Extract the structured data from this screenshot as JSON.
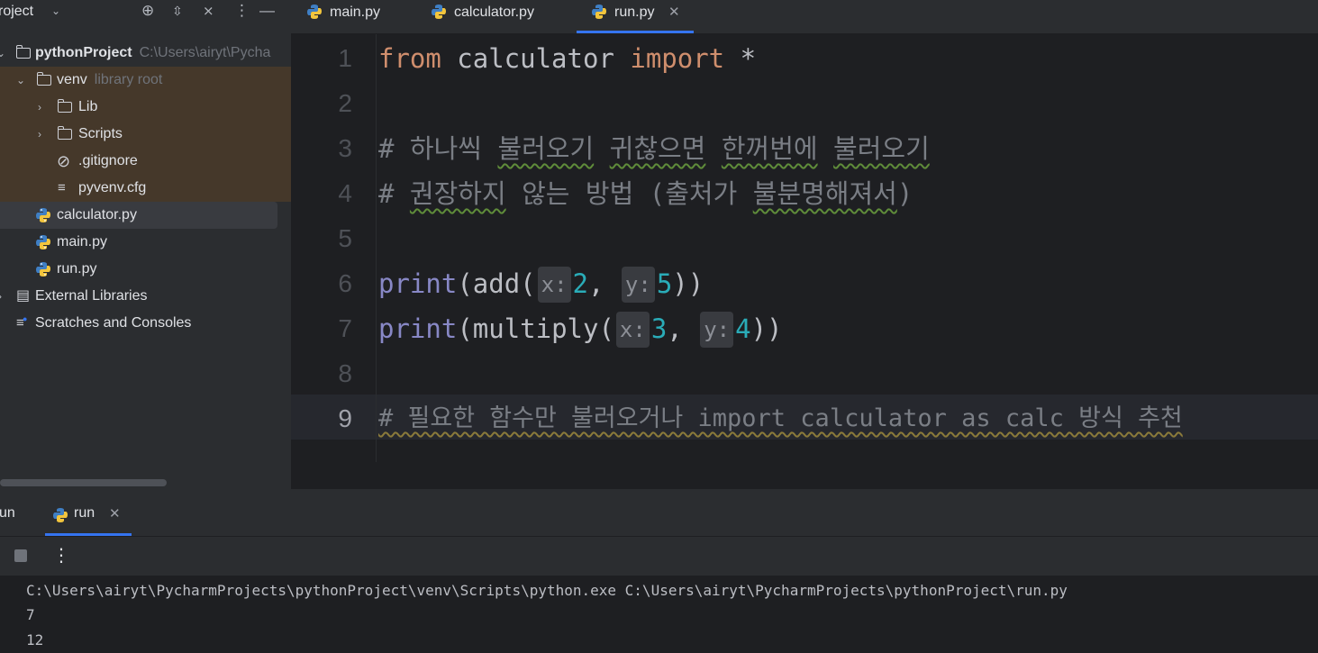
{
  "project": {
    "title": "roject",
    "tree": [
      {
        "label": "pythonProject",
        "hint": "C:\\Users\\airyt\\Pycha",
        "type": "folder"
      },
      {
        "label": "venv",
        "hint": "library root",
        "type": "folder"
      },
      {
        "label": "Lib",
        "type": "folder"
      },
      {
        "label": "Scripts",
        "type": "folder"
      },
      {
        "label": ".gitignore",
        "type": "ignore"
      },
      {
        "label": "pyvenv.cfg",
        "type": "text"
      },
      {
        "label": "calculator.py",
        "type": "python"
      },
      {
        "label": "main.py",
        "type": "python"
      },
      {
        "label": "run.py",
        "type": "python"
      },
      {
        "label": "External Libraries",
        "type": "library"
      },
      {
        "label": "Scratches and Consoles",
        "type": "scratch"
      }
    ]
  },
  "editor": {
    "tabs": [
      {
        "label": "main.py"
      },
      {
        "label": "calculator.py"
      },
      {
        "label": "run.py",
        "active": true
      }
    ],
    "line_numbers": [
      "1",
      "2",
      "3",
      "4",
      "5",
      "6",
      "7",
      "8",
      "9"
    ],
    "code": {
      "l1_kw1": "from",
      "l1_mid": " calculator ",
      "l1_kw2": "import",
      "l1_end": " *",
      "l3_hash": "# ",
      "l3_w1": "하나씩",
      "l3_w2": "불러오기",
      "l3_w3": "귀찮으면",
      "l3_w4": "한꺼번에",
      "l3_w5": "불러오기",
      "l4_hash": "# ",
      "l4_w1": "권장하지",
      "l4_w2": " 않는 방법 (출처가 ",
      "l4_w3": "불분명해져서",
      "l4_end": ")",
      "l6_fn": "print",
      "l6_a": "(add(",
      "l6_h1": "x:",
      "l6_n1": "2",
      "l6_c": ", ",
      "l6_h2": "y:",
      "l6_n2": "5",
      "l6_end": "))",
      "l7_fn": "print",
      "l7_a": "(multiply(",
      "l7_h1": "x:",
      "l7_n1": "3",
      "l7_c": ", ",
      "l7_h2": "y:",
      "l7_n2": "4",
      "l7_end": "))",
      "l9": "# 필요한 함수만 불러오거나 import calculator as calc 방식 추천"
    }
  },
  "run": {
    "title": "un",
    "tab_label": "run",
    "console": [
      "C:\\Users\\airyt\\PycharmProjects\\pythonProject\\venv\\Scripts\\python.exe C:\\Users\\airyt\\PycharmProjects\\pythonProject\\run.py",
      "7",
      "12"
    ]
  },
  "colors": {
    "accent": "#3574f0",
    "keyword": "#cf8e6d",
    "comment": "#7a7e85",
    "number": "#2aacb8",
    "builtin": "#8888c6"
  }
}
